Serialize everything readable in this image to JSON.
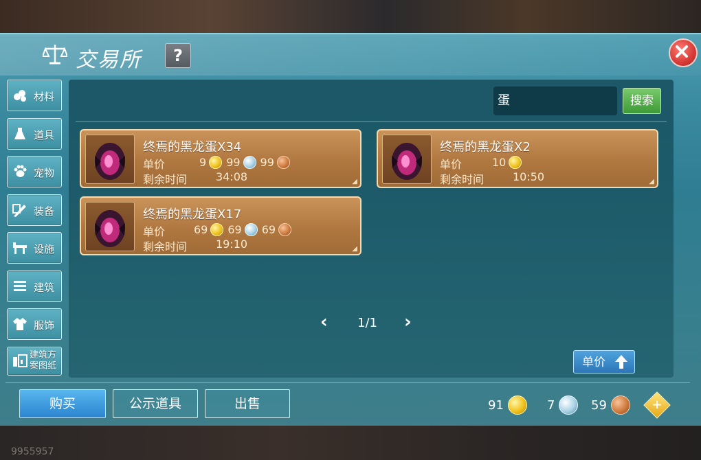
{
  "window": {
    "title": "交易所",
    "help_label": "?",
    "close_label": "×"
  },
  "sidebar": {
    "items": [
      {
        "label": "材料",
        "icon": "material-icon"
      },
      {
        "label": "道具",
        "icon": "item-icon"
      },
      {
        "label": "宠物",
        "icon": "pet-icon"
      },
      {
        "label": "装备",
        "icon": "equipment-icon"
      },
      {
        "label": "设施",
        "icon": "facility-icon"
      },
      {
        "label": "建筑",
        "icon": "building-icon"
      },
      {
        "label": "服饰",
        "icon": "clothing-icon"
      },
      {
        "label": "建筑方案图纸",
        "icon": "blueprint-icon"
      }
    ]
  },
  "search": {
    "value": "蛋",
    "button_label": "搜索"
  },
  "listings": [
    {
      "name": "终焉的黑龙蛋X34",
      "price_label": "单价",
      "prices": [
        {
          "amount": "9",
          "coin": "gold"
        },
        {
          "amount": "99",
          "coin": "silver"
        },
        {
          "amount": "99",
          "coin": "copper"
        }
      ],
      "time_label": "剩余时间",
      "time_value": "34:08"
    },
    {
      "name": "终焉的黑龙蛋X2",
      "price_label": "单价",
      "prices": [
        {
          "amount": "10",
          "coin": "gold"
        }
      ],
      "time_label": "剩余时间",
      "time_value": "10:50"
    },
    {
      "name": "终焉的黑龙蛋X17",
      "price_label": "单价",
      "prices": [
        {
          "amount": "69",
          "coin": "gold"
        },
        {
          "amount": "69",
          "coin": "silver"
        },
        {
          "amount": "69",
          "coin": "copper"
        }
      ],
      "time_label": "剩余时间",
      "time_value": "19:10"
    }
  ],
  "pager": {
    "prev": "‹",
    "text": "1/1",
    "next": "›"
  },
  "sort": {
    "label": "单价"
  },
  "actions": {
    "buy": "购买",
    "public_items": "公示道具",
    "sell": "出售"
  },
  "currency": {
    "gold": "91",
    "silver": "7",
    "copper": "59",
    "add_label": "+"
  },
  "footer": {
    "player_id": "9955957"
  },
  "colors": {
    "accent_blue": "#2c84cf",
    "search_green": "#3d9a37",
    "listing_bg": "#b07840",
    "window_teal": "#377f8f"
  }
}
